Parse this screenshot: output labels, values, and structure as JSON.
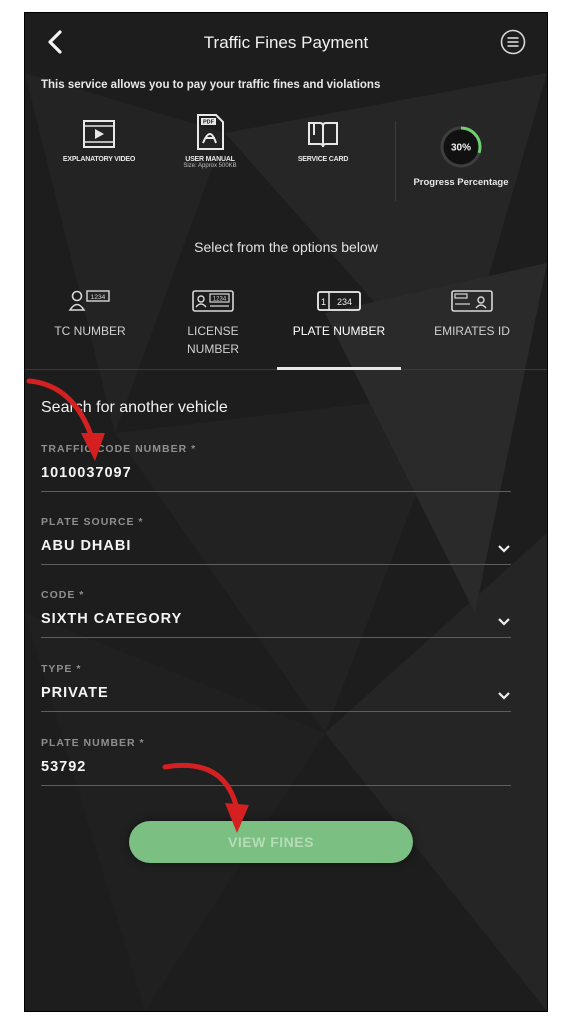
{
  "header": {
    "title": "Traffic Fines Payment",
    "back_icon": "chevron-left-icon",
    "menu_icon": "menu-circle-icon"
  },
  "description": "This service allows you to pay your traffic fines and violations",
  "tools": [
    {
      "label": "EXPLANATORY VIDEO",
      "icon": "video-icon"
    },
    {
      "label": "USER MANUAL",
      "sublabel": "Size: Approx 500KB",
      "icon": "pdf-icon",
      "badge": "PDF"
    },
    {
      "label": "SERVICE CARD",
      "icon": "book-icon"
    }
  ],
  "progress": {
    "value": 30,
    "value_text": "30%",
    "label": "Progress Percentage"
  },
  "select_text": "Select from the options below",
  "tabs": [
    {
      "label": "TC NUMBER",
      "icon": "person-id-icon",
      "icon_text": "1234"
    },
    {
      "label": "LICENSE NUMBER",
      "icon": "license-card-icon",
      "icon_text": "1234"
    },
    {
      "label": "PLATE NUMBER",
      "icon": "plate-icon",
      "icon_text_left": "1",
      "icon_text_right": "234",
      "active": true
    },
    {
      "label": "EMIRATES ID",
      "icon": "emirates-id-icon"
    }
  ],
  "form": {
    "title": "Search for another vehicle",
    "fields": [
      {
        "label": "TRAFFIC CODE NUMBER *",
        "value": "1010037097",
        "dropdown": false
      },
      {
        "label": "PLATE SOURCE *",
        "value": "ABU DHABI",
        "dropdown": true
      },
      {
        "label": "CODE *",
        "value": "SIXTH CATEGORY",
        "dropdown": true
      },
      {
        "label": "TYPE *",
        "value": "PRIVATE",
        "dropdown": true
      },
      {
        "label": "PLATE NUMBER *",
        "value": "53792",
        "dropdown": false
      }
    ]
  },
  "button": {
    "label": "VIEW FINES"
  },
  "colors": {
    "background": "#1d1d1d",
    "button": "#7cbf82",
    "progress": "#6fcf6f",
    "annotation_arrow": "#d42020"
  }
}
